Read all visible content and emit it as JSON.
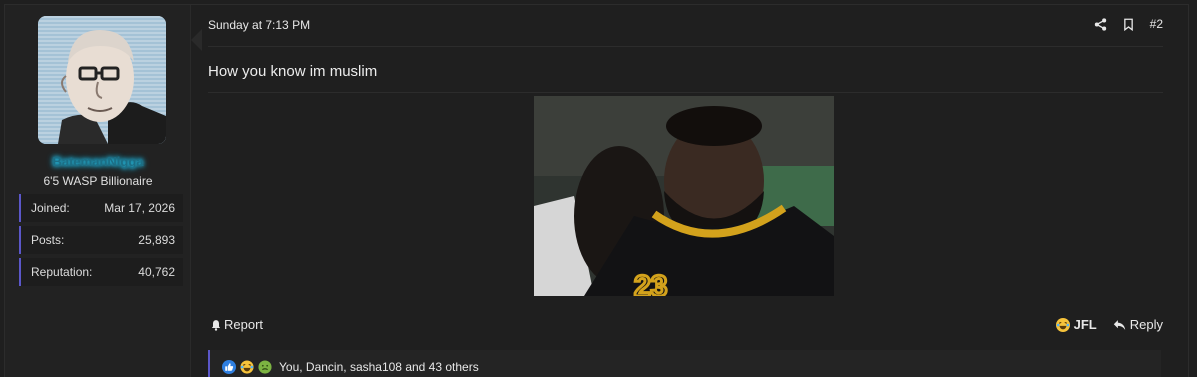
{
  "user": {
    "username": "BatemanNigga",
    "title": "6'5 WASP Billionaire",
    "stats": [
      {
        "label": "Joined:",
        "value": "Mar 17, 2026"
      },
      {
        "label": "Posts:",
        "value": "25,893"
      },
      {
        "label": "Reputation:",
        "value": "40,762"
      }
    ]
  },
  "post": {
    "timestamp": "Sunday at 7:13 PM",
    "number": "#2",
    "message": "How you know im muslim",
    "report_label": "Report",
    "jfl_label": "JFL",
    "reply_label": "Reply",
    "reactions_text": "You, Dancin, sasha108 and 43 others"
  },
  "icons": {
    "share": "share-icon",
    "bookmark": "bookmark-icon",
    "bell": "bell-icon",
    "laugh": "laughing-emoji",
    "reply": "reply-arrow-icon",
    "like": "thumbs-up-icon",
    "sick": "nauseated-emoji"
  },
  "colors": {
    "accent": "#5b57c9",
    "username_glow": "#2ad6ff",
    "background": "#1f1f1f"
  }
}
